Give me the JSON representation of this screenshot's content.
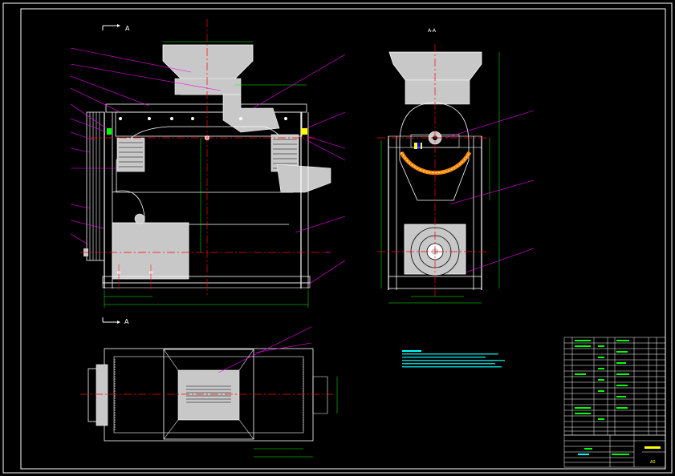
{
  "colors": {
    "background": "#000000",
    "outline": "#ffffff",
    "centerline": "#ff0000",
    "dimension": "#00ff00",
    "leader": "#ff00ff",
    "notes": "#00ffff",
    "fill_gray": "#c8c8c8",
    "highlight": "#ffff00"
  },
  "views": {
    "front": {
      "label": "A"
    },
    "side": {
      "label": "A-A"
    },
    "top": {
      "label": "A"
    }
  },
  "title_block": {
    "scale_label": "A0"
  }
}
